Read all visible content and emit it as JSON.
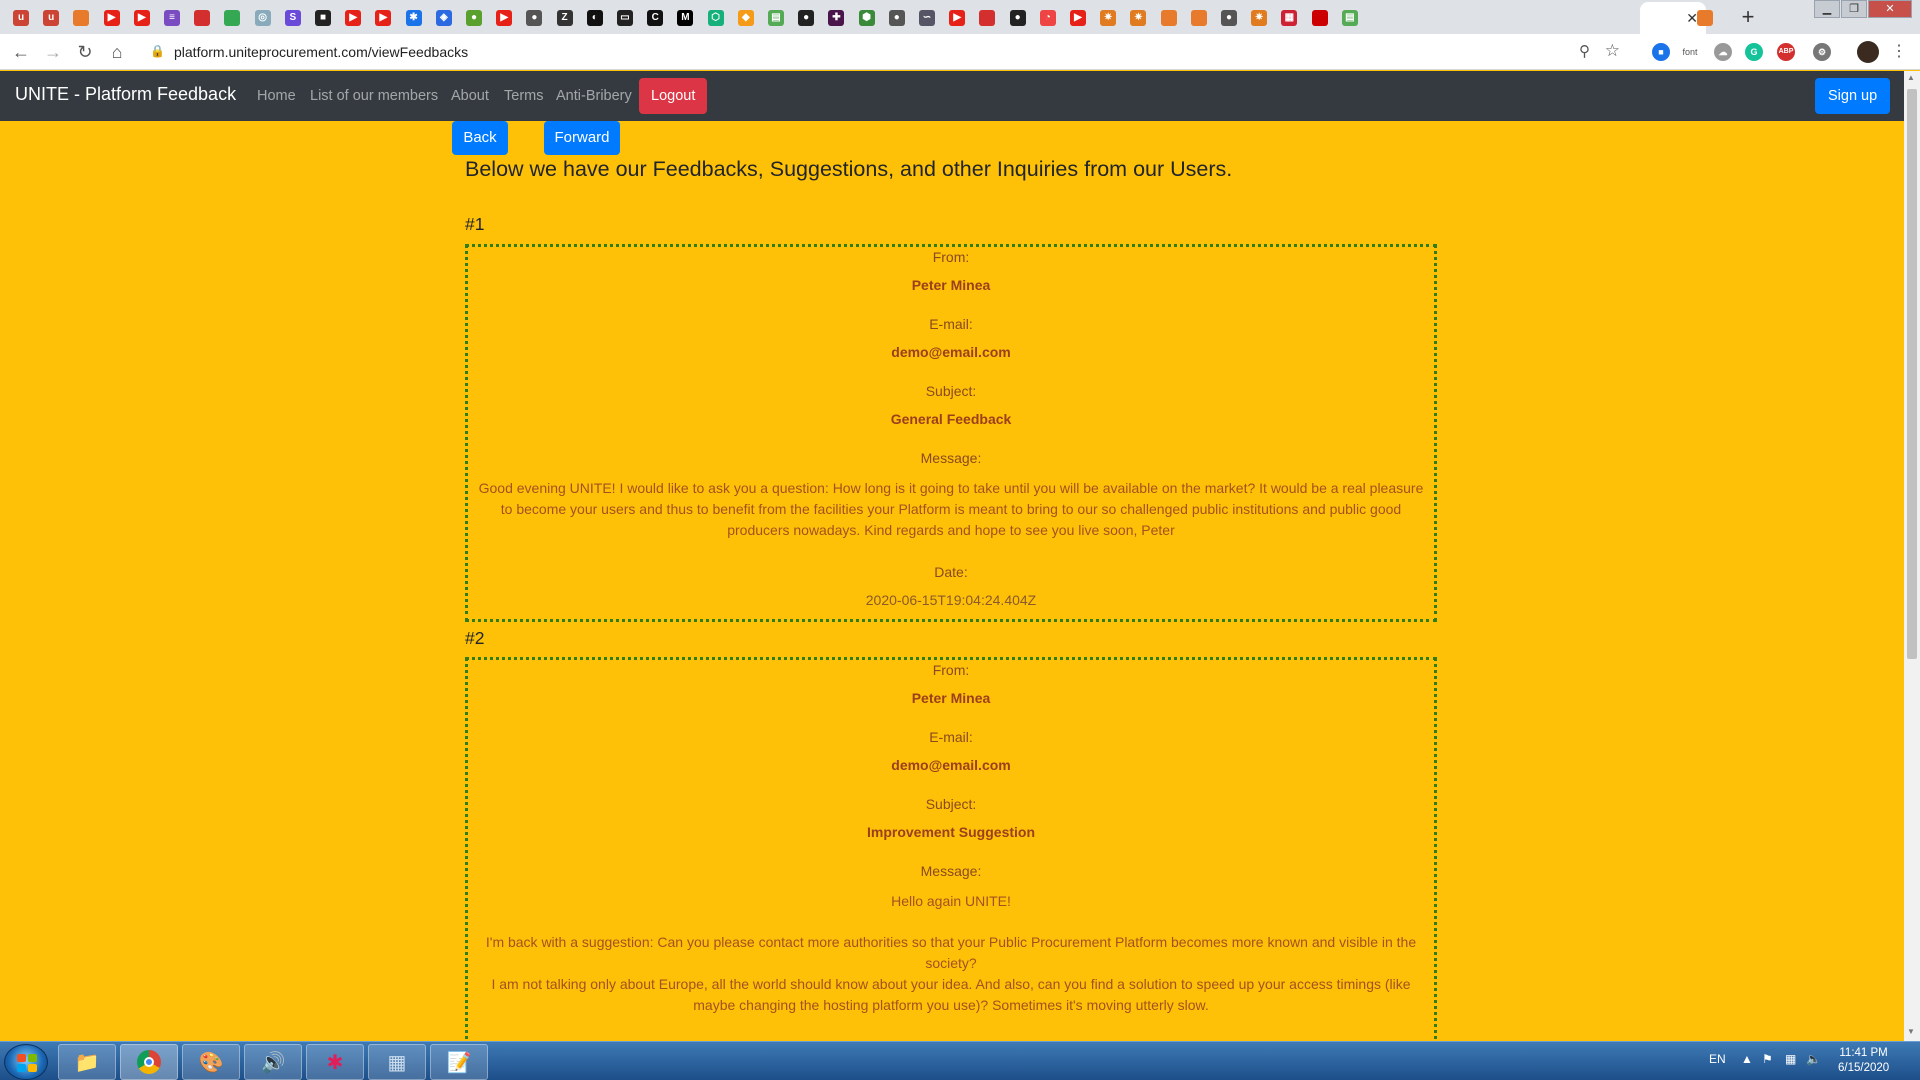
{
  "browser": {
    "address_url": "platform.uniteprocurement.com/viewFeedbacks",
    "tab_close_glyph": "✕",
    "new_tab_glyph": "+",
    "ext_font_label": "font",
    "ext_abp_label": "ABP"
  },
  "navbar": {
    "brand": "UNITE - Platform Feedback",
    "links": [
      "Home",
      "List of our members",
      "About",
      "Terms",
      "Anti-Bribery"
    ],
    "logout_label": "Logout",
    "signup_label": "Sign up"
  },
  "page": {
    "back_label": "Back",
    "forward_label": "Forward",
    "heading": "Below we have our Feedbacks, Suggestions, and other Inquiries from our Users."
  },
  "labels": {
    "from": "From:",
    "email": "E-mail:",
    "subject": "Subject:",
    "message": "Message:",
    "date": "Date:"
  },
  "feedbacks": [
    {
      "number": "#1",
      "from": "Peter Minea",
      "email": "demo@email.com",
      "subject": "General Feedback",
      "message": "Good evening UNITE! I would like to ask you a question: How long is it going to take until you will be available on the market? It would be a real pleasure to become your users and thus to benefit from the facilities your Platform is meant to bring to our so challenged public institutions and public good producers nowadays. Kind regards and hope to see you live soon, Peter",
      "date": "2020-06-15T19:04:24.404Z"
    },
    {
      "number": "#2",
      "from": "Peter Minea",
      "email": "demo@email.com",
      "subject": "Improvement Suggestion",
      "message_greeting": "Hello again UNITE!",
      "message_line1": "I'm back with a suggestion: Can you please contact more authorities so that your Public Procurement Platform becomes more known and visible in the society?",
      "message_line2": "I am not talking only about Europe, all the world should know about your idea. And also, can you find a solution to speed up your access timings (like maybe changing the hosting platform you use)? Sometimes it's moving utterly slow."
    }
  ],
  "taskbar": {
    "language": "EN",
    "time": "11:41 PM",
    "date": "6/15/2020"
  },
  "icons": {
    "tabs": [
      "acrobat-icon",
      "acrobat-icon",
      "stackoverflow-icon",
      "youtube-icon",
      "youtube-icon",
      "stack-icon",
      "dictionary-icon",
      "maps-icon",
      "globe-icon",
      "s-icon",
      "square-icon",
      "youtube-icon",
      "youtube-icon",
      "gear-icon",
      "cube-icon",
      "leaf-icon",
      "youtube-icon",
      "site-icon",
      "z-icon",
      "circle-icon",
      "slash-icon",
      "c-icon",
      "medium-icon",
      "shield-icon",
      "brave-icon",
      "stats-icon",
      "github-icon",
      "slack-icon",
      "node-icon",
      "site-icon",
      "link-icon",
      "youtube-icon",
      "dictionary-icon",
      "github-icon",
      "clock-icon",
      "youtube-icon",
      "star-icon",
      "star-icon",
      "stackoverflow-icon",
      "stackoverflow-icon",
      "site-icon",
      "star-icon",
      "grid-icon",
      "cnn-icon",
      "stats-icon"
    ]
  },
  "colors": {
    "page_bg": "#ffc107",
    "navbar_bg": "#343a40",
    "primary": "#007bff",
    "danger": "#dc3545",
    "card_border": "#2f7d1b"
  }
}
